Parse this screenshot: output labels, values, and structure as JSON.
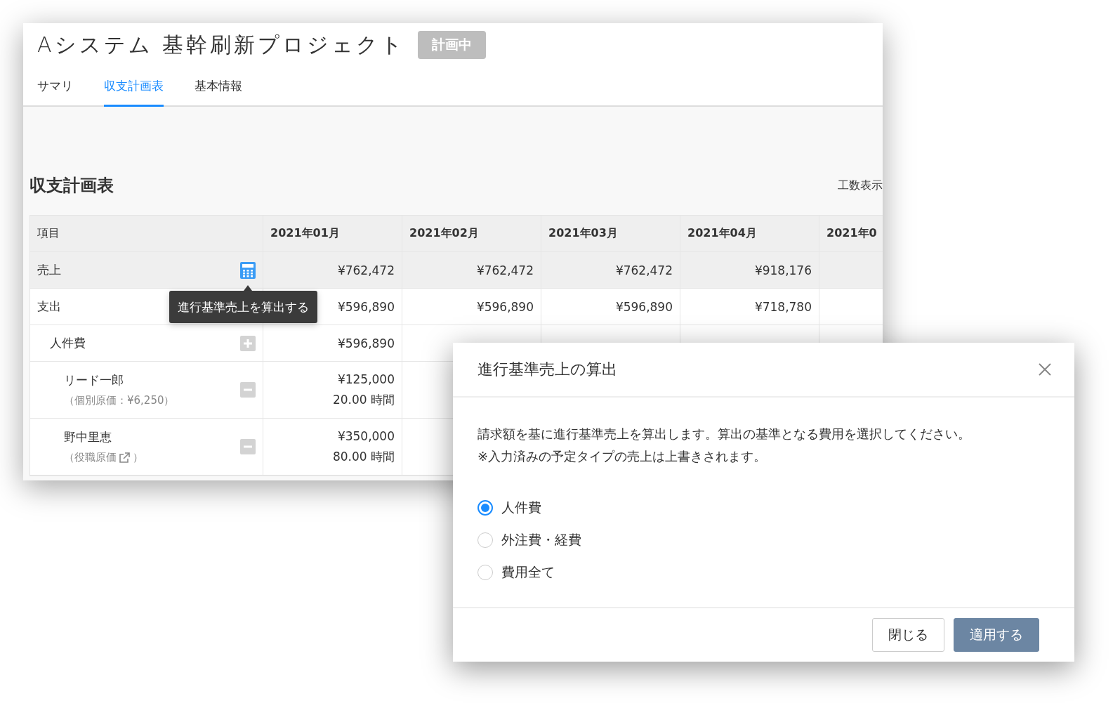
{
  "window": {
    "title": "Aシステム 基幹刷新プロジェクト",
    "status_badge": "計画中"
  },
  "tabs": [
    {
      "label": "サマリ",
      "selected": false
    },
    {
      "label": "収支計画表",
      "selected": true
    },
    {
      "label": "基本情報",
      "selected": false
    }
  ],
  "section": {
    "title": "収支計画表",
    "toggle_label": "工数表示"
  },
  "table": {
    "columns": [
      "項目",
      "2021年01月",
      "2021年02月",
      "2021年03月",
      "2021年04月",
      "2021年0"
    ],
    "rows": [
      {
        "label": "売上",
        "kind": "calc",
        "shaded": true,
        "values": [
          "¥762,472",
          "¥762,472",
          "¥762,472",
          "¥918,176"
        ]
      },
      {
        "label": "支出",
        "kind": "plain",
        "shaded": false,
        "values": [
          "¥596,890",
          "¥596,890",
          "¥596,890",
          "¥718,780"
        ]
      },
      {
        "label": "人件費",
        "kind": "add",
        "shaded": false,
        "values": [
          "¥596,890"
        ],
        "children": [
          {
            "label": "リード一郎",
            "kind": "remove",
            "note": "（個別原価：¥6,250）",
            "values": [
              [
                "¥125,000",
                "20.00 時間"
              ]
            ]
          },
          {
            "label": "野中里恵",
            "kind": "remove",
            "note": "（役職原価",
            "note_link": true,
            "note_close": "）",
            "values": [
              [
                "¥350,000",
                "80.00 時間"
              ]
            ]
          }
        ]
      }
    ]
  },
  "tooltip": {
    "text": "進行基準売上を算出する"
  },
  "dialog": {
    "title": "進行基準売上の算出",
    "message": "請求額を基に進行基準売上を算出します。算出の基準となる費用を選択してください。",
    "note": "※入力済みの予定タイプの売上は上書きされます。",
    "options": [
      {
        "label": "人件費",
        "selected": true
      },
      {
        "label": "外注費・経費",
        "selected": false
      },
      {
        "label": "費用全て",
        "selected": false
      }
    ],
    "buttons": [
      {
        "label": "閉じる",
        "kind": "secondary"
      },
      {
        "label": "適用する",
        "kind": "primary"
      }
    ]
  }
}
